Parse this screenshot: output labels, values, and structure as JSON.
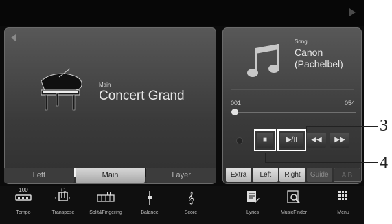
{
  "voice": {
    "kind_label": "Main",
    "name": "Concert Grand",
    "part_tabs": [
      "Left",
      "Main",
      "Layer"
    ],
    "active_tab": "Main"
  },
  "song": {
    "kind_label": "Song",
    "title": "Canon (Pachelbel)",
    "position_start": "001",
    "position_end": "054",
    "position_fraction": 0.0,
    "transport": {
      "stop": "■",
      "play_pause": "▶/II",
      "rewind": "◀◀",
      "fast_forward": "▶▶"
    },
    "tabs": [
      "Extra",
      "Left",
      "Right",
      "Guide"
    ],
    "ab_label": "A  B"
  },
  "functions": [
    {
      "label": "Tempo",
      "value": "100",
      "icon": "tempo-icon"
    },
    {
      "label": "Transpose",
      "value": "+1",
      "icon": "transpose-icon"
    },
    {
      "label": "Split&Fingering",
      "value": "",
      "icon": "split-icon"
    },
    {
      "label": "Balance",
      "value": "",
      "icon": "balance-icon"
    },
    {
      "label": "Score",
      "value": "",
      "icon": "treble-clef-icon"
    },
    {
      "label": "Lyrics",
      "value": "",
      "icon": "lyrics-icon"
    },
    {
      "label": "MusicFinder",
      "value": "",
      "icon": "musicfinder-icon"
    },
    {
      "label": "Menu",
      "value": "",
      "icon": "menu-grid-icon"
    }
  ],
  "annotations": [
    "3",
    "4"
  ],
  "colors": {
    "screen_bg": "#0b0b0b",
    "panel_bg": "#4a4a4a",
    "active_tab": "#c4c4c4",
    "callout": "#ffffff"
  }
}
